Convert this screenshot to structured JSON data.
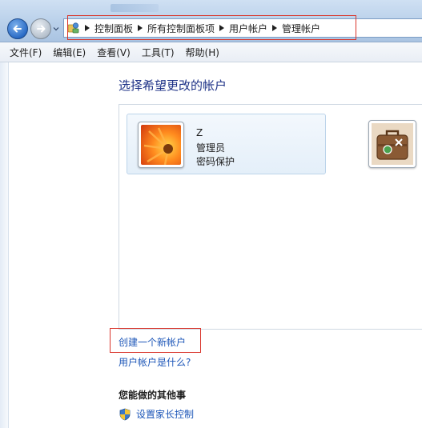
{
  "address_bar": {
    "breadcrumbs": [
      {
        "label": "控制面板"
      },
      {
        "label": "所有控制面板项"
      },
      {
        "label": "用户帐户"
      },
      {
        "label": "管理帐户"
      }
    ]
  },
  "menubar": {
    "items": [
      {
        "label": "文件(F)"
      },
      {
        "label": "编辑(E)"
      },
      {
        "label": "查看(V)"
      },
      {
        "label": "工具(T)"
      },
      {
        "label": "帮助(H)"
      }
    ]
  },
  "main": {
    "title": "选择希望更改的帐户",
    "accounts": [
      {
        "name": "Z",
        "role": "管理员",
        "status": "密码保护",
        "icon": "orange-flower-picture"
      },
      {
        "icon": "brown-suitcase-picture"
      }
    ],
    "create_link": "创建一个新帐户",
    "what_is_link": "用户帐户是什么?",
    "other_tasks_heading": "您能做的其他事",
    "tasks": [
      {
        "label": "设置家长控制",
        "icon": "uac-shield-icon"
      }
    ]
  },
  "colors": {
    "highlight_box": "#d9352b",
    "link": "#1c56b8",
    "title": "#1e3287"
  }
}
